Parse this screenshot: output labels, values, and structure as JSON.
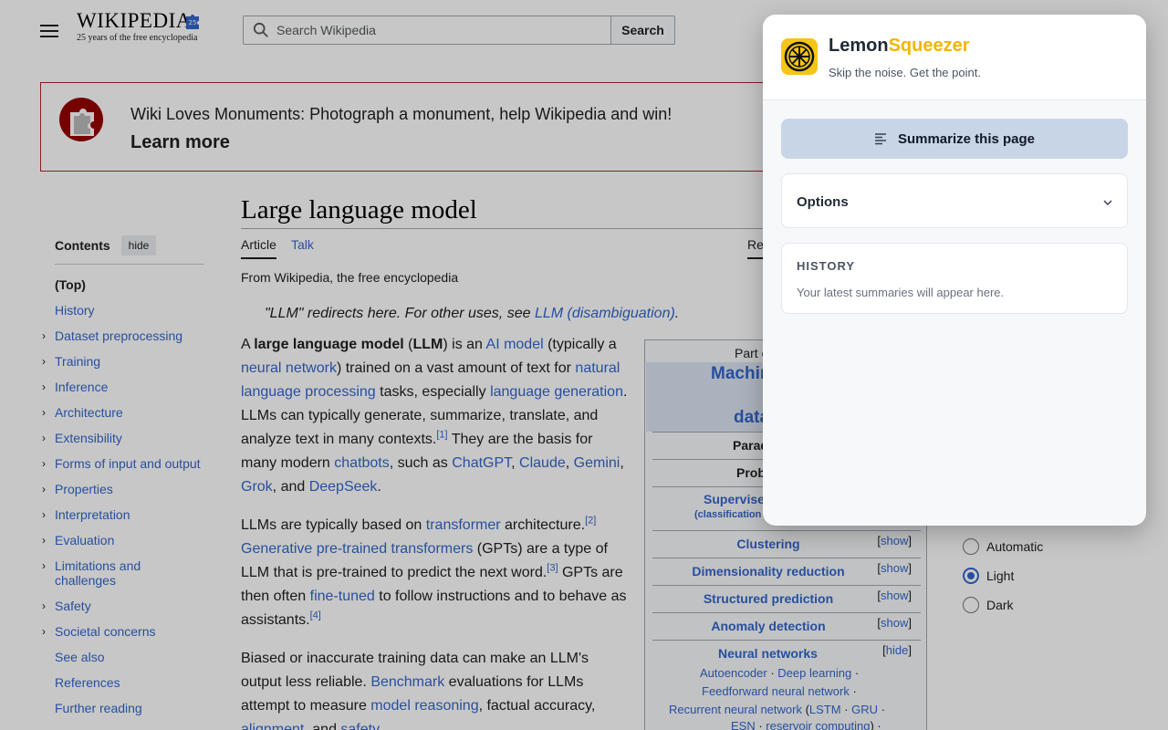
{
  "header": {
    "logo_word": "Wikipedia",
    "logo_tagline": "25 years of the free encyclopedia",
    "search_placeholder": "Search Wikipedia",
    "search_button": "Search"
  },
  "banner": {
    "text": "Wiki Loves Monuments: Photograph a monument, help Wikipedia and win!",
    "link": "Learn more"
  },
  "toc": {
    "title": "Contents",
    "hide": "hide",
    "items": [
      {
        "label": "(Top)",
        "expandable": false
      },
      {
        "label": "History",
        "expandable": false
      },
      {
        "label": "Dataset preprocessing",
        "expandable": true
      },
      {
        "label": "Training",
        "expandable": true
      },
      {
        "label": "Inference",
        "expandable": true
      },
      {
        "label": "Architecture",
        "expandable": true
      },
      {
        "label": "Extensibility",
        "expandable": true
      },
      {
        "label": "Forms of input and output",
        "expandable": true
      },
      {
        "label": "Properties",
        "expandable": true
      },
      {
        "label": "Interpretation",
        "expandable": true
      },
      {
        "label": "Evaluation",
        "expandable": true
      },
      {
        "label": "Limitations and challenges",
        "expandable": true
      },
      {
        "label": "Safety",
        "expandable": true
      },
      {
        "label": "Societal concerns",
        "expandable": true
      },
      {
        "label": "See also",
        "expandable": false
      },
      {
        "label": "References",
        "expandable": false
      },
      {
        "label": "Further reading",
        "expandable": false
      }
    ]
  },
  "article": {
    "title": "Large language model",
    "tab_article": "Article",
    "tab_talk": "Talk",
    "tab_read": "Read",
    "from": "From Wikipedia, the free encyclopedia",
    "hatnote_pre": "\"LLM\" redirects here. For other uses, see ",
    "hatnote_link": "LLM (disambiguation)",
    "hatnote_post": ".",
    "p1": {
      "t1": "A ",
      "b1": "large language model",
      "t2": " (",
      "b2": "LLM",
      "t3": ") is an ",
      "l1": "AI model",
      "t4": " (typically a ",
      "l2": "neural network",
      "t5": ") trained on a vast amount of text for ",
      "l3": "natural language processing",
      "t6": " tasks, especially ",
      "l4": "language generation",
      "t7": ". LLMs can typically generate, summarize, translate, and analyze text in many contexts.",
      "ref1": "[1]",
      "t8": " They are the basis for many modern ",
      "l5": "chatbots",
      "t9": ", such as ",
      "l6": "ChatGPT",
      "c1": ", ",
      "l7": "Claude",
      "c2": ", ",
      "l8": "Gemini",
      "c3": ", ",
      "l9": "Grok",
      "t10": ", and ",
      "l10": "DeepSeek",
      "t11": "."
    },
    "p2": {
      "t1": "LLMs are typically based on ",
      "l1": "transformer",
      "t2": " architecture.",
      "ref2": "[2]",
      "t3": " ",
      "l2": "Generative pre-trained transformers",
      "t4": " (GPTs) are a type of LLM that is pre-trained to predict the next word.",
      "ref3": "[3]",
      "t5": " GPTs are then often ",
      "l3": "fine-tuned",
      "t6": " to follow instructions and to behave as assistants.",
      "ref4": "[4]"
    },
    "p3": {
      "t1": "Biased or inaccurate training data can make an LLM's output less reliable. ",
      "l1": "Benchmark",
      "t2": " evaluations for LLMs attempt to measure ",
      "l2": "model reasoning",
      "t3": ", factual accuracy, ",
      "l3": "alignment",
      "t4": ", and ",
      "l4": "safety",
      "t5": "."
    }
  },
  "infobox": {
    "partof": "Part of",
    "title1": "Machine learning",
    "title2": "data mining",
    "paradigms": "Paradigms",
    "problems": "Problems",
    "supervised": "Supervised learning",
    "supervised_sub": "(classification • regression)",
    "rows": [
      {
        "label": "Clustering",
        "show": "show"
      },
      {
        "label": "Dimensionality reduction",
        "show": "show"
      },
      {
        "label": "Structured prediction",
        "show": "show"
      },
      {
        "label": "Anomaly detection",
        "show": "show"
      }
    ],
    "nn_label": "Neural networks",
    "nn_hide": "hide",
    "nn_links": [
      "Autoencoder",
      "Deep learning",
      "Feedforward neural network",
      "Recurrent neural network",
      "LSTM",
      "GRU",
      "ESN",
      "reservoir computing"
    ]
  },
  "appearance": {
    "options": [
      {
        "label": "Automatic",
        "selected": false
      },
      {
        "label": "Light",
        "selected": true
      },
      {
        "label": "Dark",
        "selected": false
      }
    ]
  },
  "popup": {
    "name_a": "Lemon",
    "name_b": "Squeezer",
    "tagline": "Skip the noise. Get the point.",
    "summarize_label": "Summarize this page",
    "options_label": "Options",
    "history_label": "HISTORY",
    "history_empty": "Your latest summaries will appear here.",
    "accent_color": "#f5c518",
    "button_color": "#c8d5e6"
  }
}
